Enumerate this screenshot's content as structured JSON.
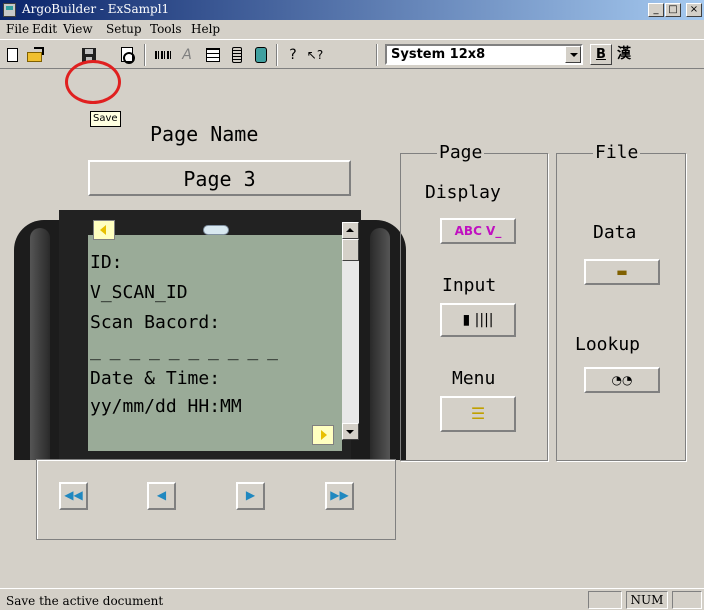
{
  "window": {
    "title": "ArgoBuilder - ExSampl1",
    "minimize_label": "_",
    "maximize_label": "□",
    "close_label": "×"
  },
  "menu": {
    "file": "File",
    "edit": "Edit",
    "view": "View",
    "setup": "Setup",
    "tools": "Tools",
    "help": "Help"
  },
  "toolbar": {
    "font_select_value": "System 12x8",
    "bold_label": "B",
    "kanji_label": "漢",
    "help_glyph": "?",
    "context_help_glyph": "↖?",
    "text_glyph": "A",
    "save_tooltip": "Save"
  },
  "editor": {
    "page_name_label": "Page Name",
    "page_name_value": "Page 3",
    "screen_lines": [
      "ID:",
      "V_SCAN_ID",
      "Scan Bacord:",
      "_ _ _ _ _ _ _ _ _ _",
      "Date & Time:",
      "yy/mm/dd HH:MM"
    ]
  },
  "nav_buttons": {
    "first": "◀◀",
    "prev": "◀",
    "next": "▶",
    "last": "▶▶"
  },
  "page_group": {
    "title": "Page",
    "display_label": "Display",
    "display_button": "ABC V_",
    "input_label": "Input",
    "input_button": "▮ ||||",
    "menu_label": "Menu",
    "menu_button": "☰"
  },
  "file_group": {
    "title": "File",
    "data_label": "Data",
    "data_button": "▬",
    "lookup_label": "Lookup",
    "lookup_button": "◔◔"
  },
  "statusbar": {
    "message": "Save the active document",
    "num": "NUM"
  },
  "colors": {
    "face": "#d4d0c8",
    "title_start": "#0a246a",
    "title_end": "#a6caf0",
    "highlight": "#e02020",
    "lcd": "#9aab98"
  }
}
